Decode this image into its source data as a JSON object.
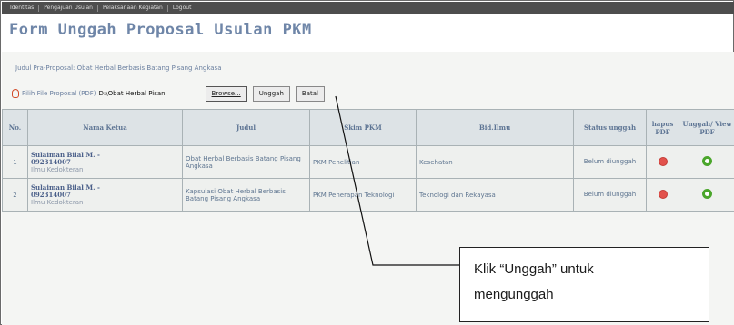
{
  "topbar": {
    "menu": [
      "Identitas",
      "Pengajuan Usulan",
      "Pelaksanaan Kegiatan",
      "Logout"
    ]
  },
  "form": {
    "title": "Form Unggah Proposal Usulan PKM",
    "judul_line": "Judul Pra-Proposal: Obat Herbal Berbasis Batang Pisang Angkasa",
    "file_label": "Pilih File Proposal (PDF)",
    "file_path": "D:\\Obat Herbal Pisan",
    "browse_label": "Browse...",
    "upload_label": "Unggah",
    "cancel_label": "Batal"
  },
  "table": {
    "headers": {
      "no": "No.",
      "ketua": "Nama Ketua",
      "judul": "Judul",
      "skim": "Skim PKM",
      "bidang": "Bid.Ilmu",
      "status": "Status unggah",
      "hapus": "hapus PDF",
      "unggah": "Unggah/ View PDF"
    },
    "rows": [
      {
        "no": "1",
        "ketua_name": "Sulaiman Bilal M. -",
        "ketua_nim": "092314007",
        "ketua_prodi": "Ilmu Kedokteran",
        "judul": "Obat Herbal Berbasis Batang Pisang Angkasa",
        "skim": "PKM Penelitian",
        "bidang": "Kesehatan",
        "status": "Belum diunggah"
      },
      {
        "no": "2",
        "ketua_name": "Sulaiman Bilal M. -",
        "ketua_nim": "092314007",
        "ketua_prodi": "Ilmu Kedokteran",
        "judul": "Kapsulasi Obat Herbal Berbasis Batang Pisang Angkasa",
        "skim": "PKM Penerapan Teknologi",
        "bidang": "Teknologi dan Rekayasa",
        "status": "Belum diunggah"
      }
    ]
  },
  "callout": {
    "line1": "Klik “Unggah” untuk",
    "line2": "mengunggah"
  },
  "colors": {
    "title": "#6f86a8",
    "status": "#d9553a",
    "delete": "#e2524c",
    "upload": "#4aa62b"
  }
}
